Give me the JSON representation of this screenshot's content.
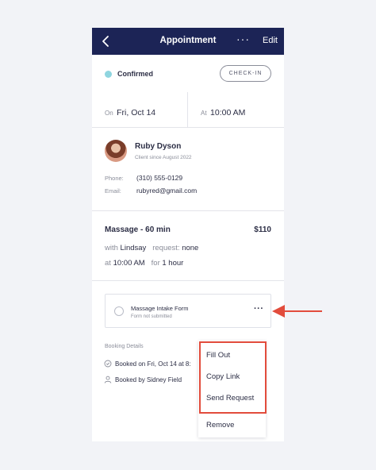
{
  "header": {
    "title": "Appointment",
    "more_label": "···",
    "edit_label": "Edit",
    "back_icon": "chevron-left-icon"
  },
  "status": {
    "label": "Confirmed",
    "dot_color": "#8fd5df",
    "checkin_label": "CHECK-IN"
  },
  "datetime": {
    "date_prefix": "On",
    "date_value": "Fri, Oct 14",
    "time_prefix": "At",
    "time_value": "10:00 AM"
  },
  "client": {
    "name": "Ruby Dyson",
    "since": "Client since August 2022",
    "phone_label": "Phone:",
    "phone_value": "(310) 555-0129",
    "email_label": "Email:",
    "email_value": "rubyred@gmail.com"
  },
  "service": {
    "name": "Massage - 60 min",
    "price": "$110",
    "with_prefix": "with",
    "with_value": "Lindsay",
    "request_prefix": "request:",
    "request_value": "none",
    "at_prefix": "at",
    "at_value": "10:00 AM",
    "for_prefix": "for",
    "for_value": "1 hour"
  },
  "form": {
    "name": "Massage Intake Form",
    "status": "Form not submitted",
    "more_label": "···"
  },
  "booking": {
    "title": "Booking Details",
    "booked_on": "Booked on Fri, Oct 14 at 8:",
    "booked_by": "Booked by Sidney Field"
  },
  "menu": {
    "items": [
      "Fill Out",
      "Copy Link",
      "Send Request",
      "Remove"
    ]
  },
  "colors": {
    "header_bg": "#1c2456",
    "highlight": "#e24c3c",
    "arrow": "#e24c3c"
  }
}
